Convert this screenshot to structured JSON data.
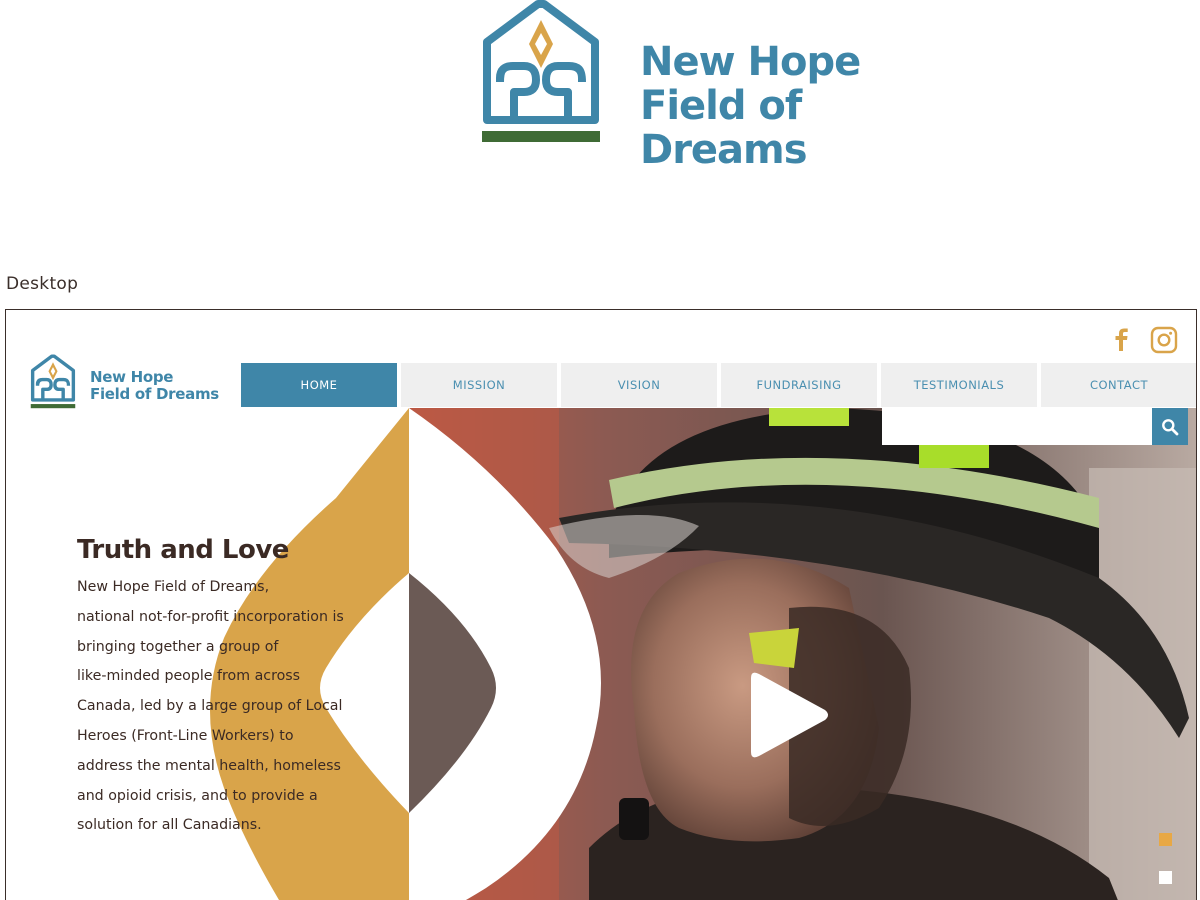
{
  "brand": {
    "name_line1": "New Hope",
    "name_line2": "Field of Dreams",
    "primary_color": "#3f86a8",
    "accent_color": "#d9a44a",
    "ground_color": "#3f6b35"
  },
  "section_label": "Desktop",
  "site": {
    "logo_line1": "New Hope",
    "logo_line2": "Field of Dreams",
    "social": {
      "facebook_icon": "facebook-icon",
      "instagram_icon": "instagram-icon",
      "icon_color": "#d9a44a"
    },
    "nav": {
      "items": [
        {
          "label": "HOME",
          "active": true
        },
        {
          "label": "MISSION",
          "active": false
        },
        {
          "label": "VISION",
          "active": false
        },
        {
          "label": "FUNDRAISING",
          "active": false
        },
        {
          "label": "TESTIMONIALS",
          "active": false
        },
        {
          "label": "CONTACT",
          "active": false
        }
      ]
    },
    "search": {
      "value": "",
      "icon": "search-icon"
    },
    "hero": {
      "title": "Truth and Love",
      "body_lines": [
        "New Hope Field of Dreams,",
        "national not-for-profit incorporation is",
        "bringing together a group of",
        "like-minded people from across",
        "Canada, led by a large group of Local",
        "Heroes (Front-Line Workers) to",
        "address the mental health, homeless",
        "and opioid crisis, and to provide a",
        "solution for all Canadians."
      ],
      "play_icon": "play-icon"
    },
    "slider": {
      "current": 1,
      "total": 2,
      "active_color": "#e8a845",
      "inactive_color": "#ffffff"
    }
  }
}
